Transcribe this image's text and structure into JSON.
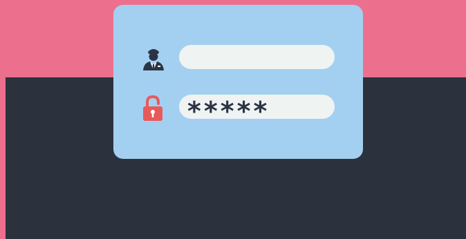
{
  "login": {
    "username": {
      "icon": "user-icon",
      "value": ""
    },
    "password": {
      "icon": "lock-icon",
      "value": "*****"
    }
  },
  "colors": {
    "background_top": "#ed6f8e",
    "background_bottom": "#2b323d",
    "card": "#a3d0f0",
    "field": "#eff3f2",
    "lock": "#e85a5a",
    "text": "#2b3445"
  }
}
